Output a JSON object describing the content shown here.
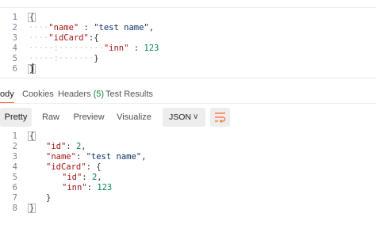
{
  "request_body": {
    "line_numbers": [
      "1",
      "2",
      "3",
      "4",
      "5",
      "6"
    ],
    "lines": [
      [
        {
          "t": "{",
          "c": "punc"
        }
      ],
      [
        {
          "t": "\"name\"",
          "c": "key"
        },
        {
          "t": " : ",
          "c": "punc"
        },
        {
          "t": "\"test name\"",
          "c": "str"
        },
        {
          "t": ",",
          "c": "punc"
        }
      ],
      [
        {
          "t": "\"idCard\"",
          "c": "key"
        },
        {
          "t": ":{",
          "c": "punc"
        }
      ],
      [
        {
          "t": "\"inn\"",
          "c": "key"
        },
        {
          "t": " : ",
          "c": "punc"
        },
        {
          "t": "123",
          "c": "num"
        }
      ],
      [
        {
          "t": "}",
          "c": "punc"
        }
      ],
      [
        {
          "t": "}",
          "c": "punc"
        }
      ]
    ]
  },
  "response_tabs": {
    "body": "ody",
    "cookies": "Cookies",
    "headers": "Headers",
    "headers_count": "(5)",
    "test_results": "Test Results"
  },
  "toolbar": {
    "pretty": "Pretty",
    "raw": "Raw",
    "preview": "Preview",
    "visualize": "Visualize",
    "format": "JSON",
    "wrap_icon": "wrap-lines-icon"
  },
  "response_body": {
    "line_numbers": [
      "1",
      "2",
      "3",
      "4",
      "5",
      "6",
      "7",
      "8"
    ],
    "lines": [
      [
        {
          "t": "{",
          "c": "punc"
        }
      ],
      [
        {
          "t": "\"id\"",
          "c": "key"
        },
        {
          "t": ": ",
          "c": "punc"
        },
        {
          "t": "2",
          "c": "num"
        },
        {
          "t": ",",
          "c": "punc"
        }
      ],
      [
        {
          "t": "\"name\"",
          "c": "key"
        },
        {
          "t": ": ",
          "c": "punc"
        },
        {
          "t": "\"test name\"",
          "c": "str"
        },
        {
          "t": ",",
          "c": "punc"
        }
      ],
      [
        {
          "t": "\"idCard\"",
          "c": "key"
        },
        {
          "t": ": {",
          "c": "punc"
        }
      ],
      [
        {
          "t": "\"id\"",
          "c": "key"
        },
        {
          "t": ": ",
          "c": "punc"
        },
        {
          "t": "2",
          "c": "num"
        },
        {
          "t": ",",
          "c": "punc"
        }
      ],
      [
        {
          "t": "\"inn\"",
          "c": "key"
        },
        {
          "t": ": ",
          "c": "punc"
        },
        {
          "t": "123",
          "c": "num"
        }
      ],
      [
        {
          "t": "}",
          "c": "punc"
        }
      ],
      [
        {
          "t": "}",
          "c": "punc"
        }
      ]
    ]
  },
  "colors": {
    "key": "#a31515",
    "string": "#0a3069",
    "number": "#098658",
    "accent": "#ff6c37",
    "count": "#0f7d3b"
  }
}
